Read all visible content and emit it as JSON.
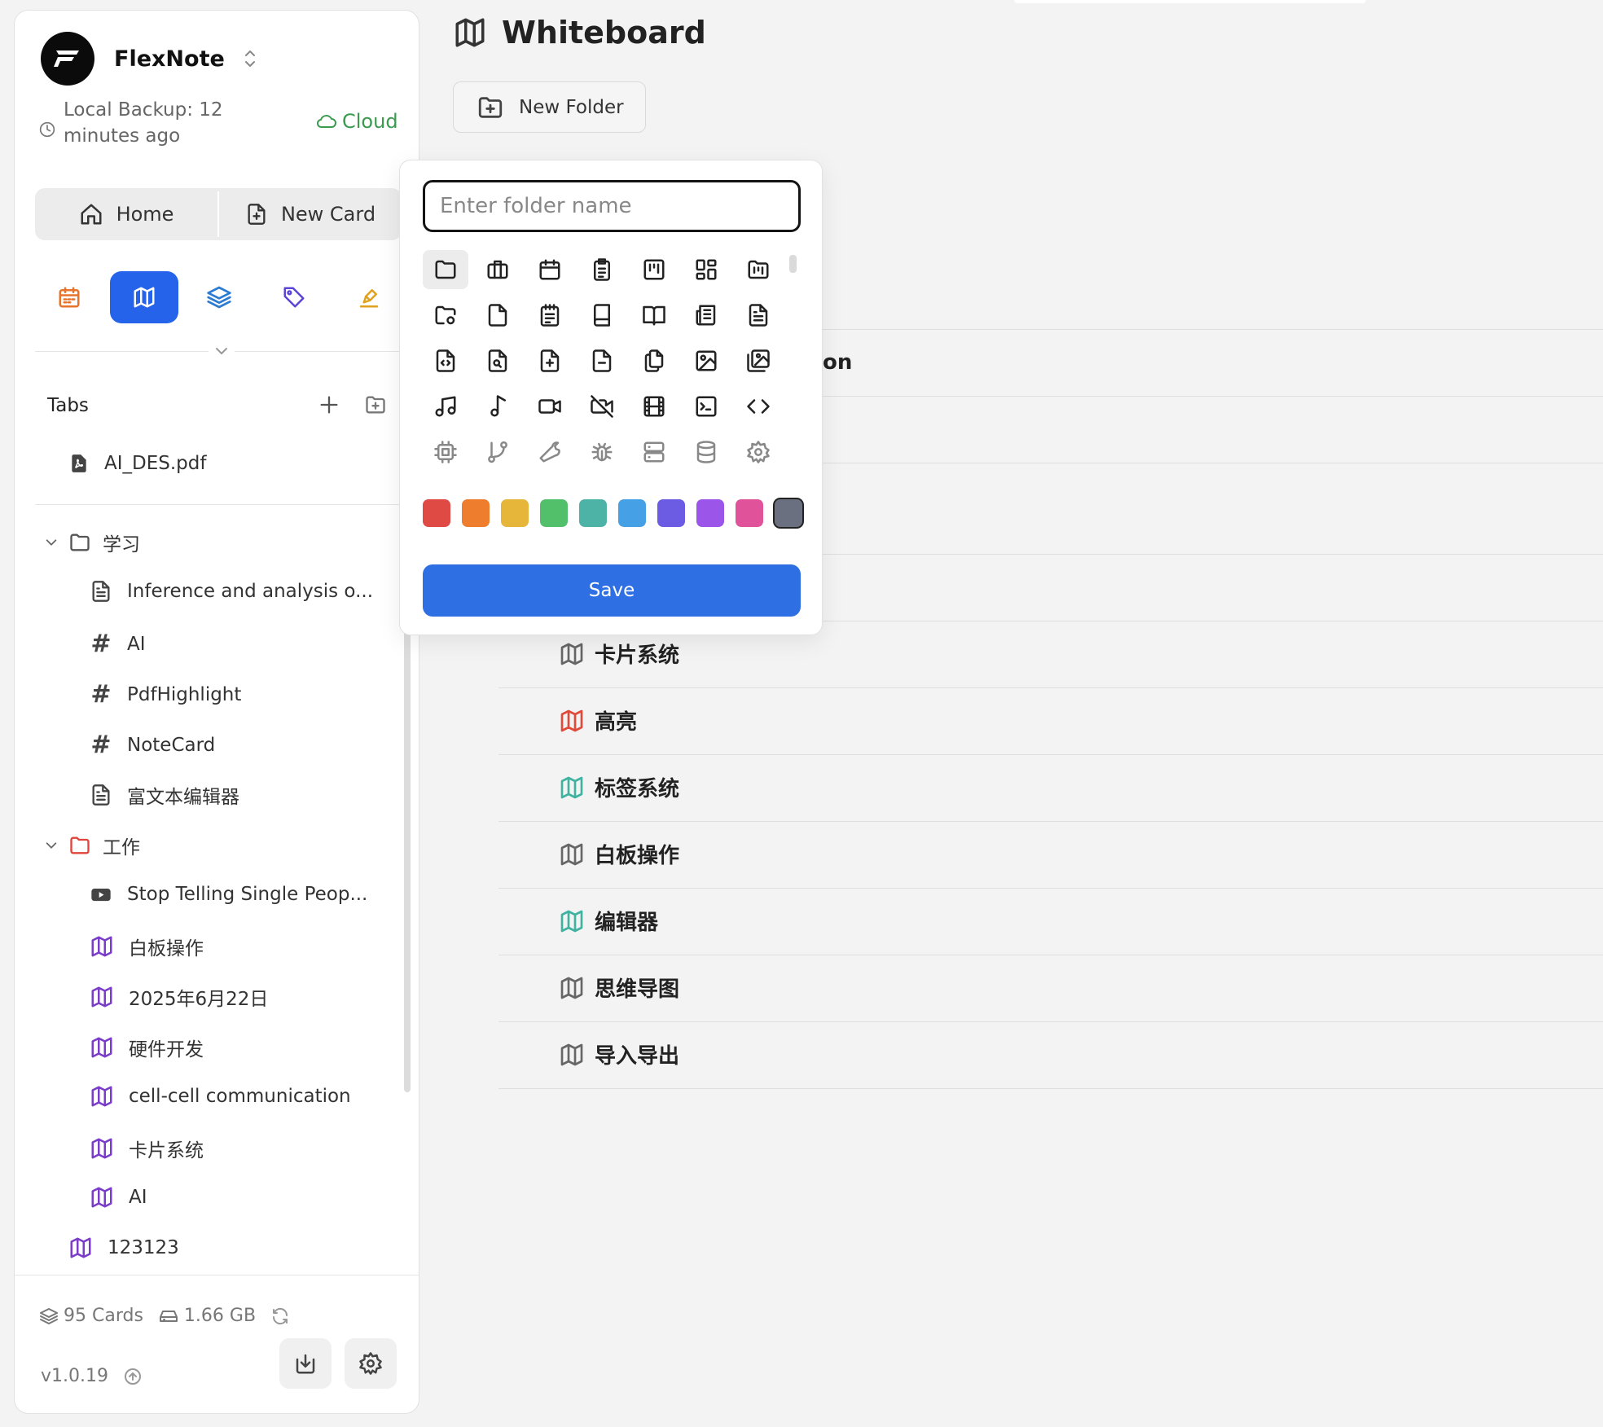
{
  "app": {
    "name": "FlexNote",
    "backup_text": "Local Backup: 12 minutes ago",
    "cloud_label": "Cloud"
  },
  "nav": {
    "home_label": "Home",
    "new_card_label": "New Card"
  },
  "modes": [
    {
      "name": "calendar-icon",
      "color": "#e8742c"
    },
    {
      "name": "map-icon",
      "color": "#ffffff",
      "active": true
    },
    {
      "name": "layers-icon",
      "color": "#2b7bd3"
    },
    {
      "name": "tag-icon",
      "color": "#5b44d8"
    },
    {
      "name": "highlighter-icon",
      "color": "#e0a21e"
    }
  ],
  "tabs": {
    "title": "Tabs",
    "items": [
      {
        "label": "AI_DES.pdf",
        "icon": "pdf-icon"
      }
    ]
  },
  "tree": {
    "folders": [
      {
        "label": "学习",
        "icon": "folder-icon",
        "color": "#555555",
        "children": [
          {
            "label": "Inference and analysis o...",
            "icon": "document-icon"
          },
          {
            "label": "AI",
            "icon": "hash-icon"
          },
          {
            "label": "PdfHighlight",
            "icon": "hash-icon"
          },
          {
            "label": "NoteCard",
            "icon": "hash-icon"
          },
          {
            "label": "富文本编辑器",
            "icon": "document-icon"
          }
        ]
      },
      {
        "label": "工作",
        "icon": "folder-icon",
        "color": "#e0443a",
        "children": [
          {
            "label": "Stop Telling Single Peop...",
            "icon": "video-icon"
          },
          {
            "label": "白板操作",
            "icon": "map-icon"
          },
          {
            "label": "2025年6月22日",
            "icon": "map-icon"
          },
          {
            "label": "硬件开发",
            "icon": "map-icon"
          },
          {
            "label": "cell-cell communication",
            "icon": "map-icon"
          },
          {
            "label": "卡片系统",
            "icon": "map-icon"
          },
          {
            "label": "AI",
            "icon": "map-icon"
          }
        ]
      }
    ],
    "root_items": [
      {
        "label": "123123",
        "icon": "map-icon"
      }
    ],
    "map_icon_color": "#7a3cc9"
  },
  "footer": {
    "cards": "95 Cards",
    "storage": "1.66 GB",
    "version": "v1.0.19"
  },
  "main": {
    "title": "Whiteboard",
    "new_folder_label": "New Folder",
    "partial_row_text": "on",
    "rows": [
      {
        "label": "卡片系统",
        "color": "#666666"
      },
      {
        "label": "高亮",
        "color": "#e04a3a"
      },
      {
        "label": "标签系统",
        "color": "#3fb3a0"
      },
      {
        "label": "白板操作",
        "color": "#666666"
      },
      {
        "label": "编辑器",
        "color": "#3fb3a0"
      },
      {
        "label": "思维导图",
        "color": "#666666"
      },
      {
        "label": "导入导出",
        "color": "#666666"
      }
    ]
  },
  "popover": {
    "input_placeholder": "Enter folder name",
    "input_value": "",
    "save_label": "Save",
    "icons": [
      "folder-icon",
      "briefcase-icon",
      "calendar-icon",
      "clipboard-list-icon",
      "kanban-icon",
      "dashboard-icon",
      "folder-kanban-icon",
      "folder-cog-icon",
      "file-icon",
      "notepad-icon",
      "book-icon",
      "book-open-icon",
      "newspaper-icon",
      "file-text-icon",
      "file-code-icon",
      "file-search-icon",
      "file-plus-icon",
      "file-minus-icon",
      "files-icon",
      "image-icon",
      "images-icon",
      "music-icon",
      "music-note-icon",
      "video-icon",
      "video-off-icon",
      "film-icon",
      "terminal-icon",
      "code-icon",
      "cpu-icon",
      "git-branch-icon",
      "wrench-icon",
      "bug-icon",
      "server-icon",
      "database-icon",
      "settings-icon"
    ],
    "selected_icon": "folder-icon",
    "colors": [
      "#e04a44",
      "#ef7d2e",
      "#e6b63a",
      "#52c06a",
      "#4db3a6",
      "#45a0e6",
      "#6c5ce4",
      "#9b55e8",
      "#e0529a",
      "#6a7080"
    ],
    "selected_color": "#6a7080"
  }
}
